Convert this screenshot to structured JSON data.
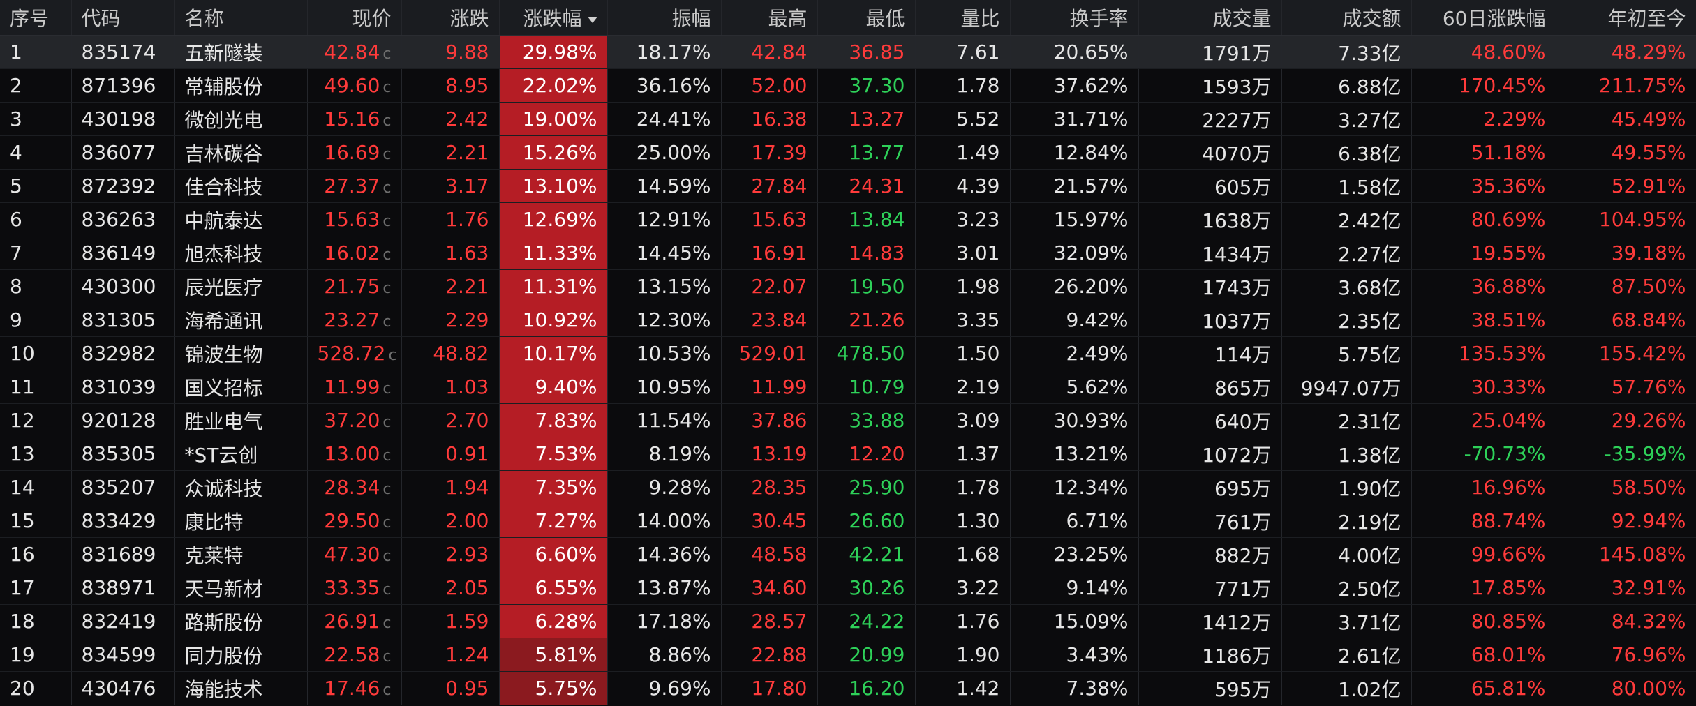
{
  "headers": [
    "序号",
    "代码",
    "名称",
    "现价",
    "涨跌",
    "涨跌幅",
    "振幅",
    "最高",
    "最低",
    "量比",
    "换手率",
    "成交量",
    "成交额",
    "60日涨跌幅",
    "年初至今"
  ],
  "colors": {
    "up": "#ff3b3b",
    "down": "#2ed159",
    "pct_bg_hot": "#b51d25",
    "pct_bg_warm": "#8b1a1f"
  },
  "sort": {
    "column": "涨跌幅",
    "direction": "desc",
    "icon": "triangle-down-icon"
  },
  "rows": [
    {
      "seq": "1",
      "code": "835174",
      "name": "五新隧装",
      "price": "42.84",
      "flag": "c",
      "change": "9.88",
      "pct": "29.98%",
      "amp": "18.17%",
      "high": "42.84",
      "high_dir": "up",
      "low": "36.85",
      "low_dir": "up",
      "vr": "7.61",
      "turn": "20.65%",
      "vol": "1791万",
      "amt": "7.33亿",
      "d60": "48.60%",
      "d60_dir": "up",
      "ytd": "48.29%",
      "ytd_dir": "up"
    },
    {
      "seq": "2",
      "code": "871396",
      "name": "常辅股份",
      "price": "49.60",
      "flag": "c",
      "change": "8.95",
      "pct": "22.02%",
      "amp": "36.16%",
      "high": "52.00",
      "high_dir": "up",
      "low": "37.30",
      "low_dir": "down",
      "vr": "1.78",
      "turn": "37.62%",
      "vol": "1593万",
      "amt": "6.88亿",
      "d60": "170.45%",
      "d60_dir": "up",
      "ytd": "211.75%",
      "ytd_dir": "up"
    },
    {
      "seq": "3",
      "code": "430198",
      "name": "微创光电",
      "price": "15.16",
      "flag": "c",
      "change": "2.42",
      "pct": "19.00%",
      "amp": "24.41%",
      "high": "16.38",
      "high_dir": "up",
      "low": "13.27",
      "low_dir": "up",
      "vr": "5.52",
      "turn": "31.71%",
      "vol": "2227万",
      "amt": "3.27亿",
      "d60": "2.29%",
      "d60_dir": "up",
      "ytd": "45.49%",
      "ytd_dir": "up"
    },
    {
      "seq": "4",
      "code": "836077",
      "name": "吉林碳谷",
      "price": "16.69",
      "flag": "c",
      "change": "2.21",
      "pct": "15.26%",
      "amp": "25.00%",
      "high": "17.39",
      "high_dir": "up",
      "low": "13.77",
      "low_dir": "down",
      "vr": "1.49",
      "turn": "12.84%",
      "vol": "4070万",
      "amt": "6.38亿",
      "d60": "51.18%",
      "d60_dir": "up",
      "ytd": "49.55%",
      "ytd_dir": "up"
    },
    {
      "seq": "5",
      "code": "872392",
      "name": "佳合科技",
      "price": "27.37",
      "flag": "c",
      "change": "3.17",
      "pct": "13.10%",
      "amp": "14.59%",
      "high": "27.84",
      "high_dir": "up",
      "low": "24.31",
      "low_dir": "up",
      "vr": "4.39",
      "turn": "21.57%",
      "vol": "605万",
      "amt": "1.58亿",
      "d60": "35.36%",
      "d60_dir": "up",
      "ytd": "52.91%",
      "ytd_dir": "up"
    },
    {
      "seq": "6",
      "code": "836263",
      "name": "中航泰达",
      "price": "15.63",
      "flag": "c",
      "change": "1.76",
      "pct": "12.69%",
      "amp": "12.91%",
      "high": "15.63",
      "high_dir": "up",
      "low": "13.84",
      "low_dir": "down",
      "vr": "3.23",
      "turn": "15.97%",
      "vol": "1638万",
      "amt": "2.42亿",
      "d60": "80.69%",
      "d60_dir": "up",
      "ytd": "104.95%",
      "ytd_dir": "up"
    },
    {
      "seq": "7",
      "code": "836149",
      "name": "旭杰科技",
      "price": "16.02",
      "flag": "c",
      "change": "1.63",
      "pct": "11.33%",
      "amp": "14.45%",
      "high": "16.91",
      "high_dir": "up",
      "low": "14.83",
      "low_dir": "up",
      "vr": "3.01",
      "turn": "32.09%",
      "vol": "1434万",
      "amt": "2.27亿",
      "d60": "19.55%",
      "d60_dir": "up",
      "ytd": "39.18%",
      "ytd_dir": "up"
    },
    {
      "seq": "8",
      "code": "430300",
      "name": "辰光医疗",
      "price": "21.75",
      "flag": "c",
      "change": "2.21",
      "pct": "11.31%",
      "amp": "13.15%",
      "high": "22.07",
      "high_dir": "up",
      "low": "19.50",
      "low_dir": "down",
      "vr": "1.98",
      "turn": "26.20%",
      "vol": "1743万",
      "amt": "3.68亿",
      "d60": "36.88%",
      "d60_dir": "up",
      "ytd": "87.50%",
      "ytd_dir": "up"
    },
    {
      "seq": "9",
      "code": "831305",
      "name": "海希通讯",
      "price": "23.27",
      "flag": "c",
      "change": "2.29",
      "pct": "10.92%",
      "amp": "12.30%",
      "high": "23.84",
      "high_dir": "up",
      "low": "21.26",
      "low_dir": "up",
      "vr": "3.35",
      "turn": "9.42%",
      "vol": "1037万",
      "amt": "2.35亿",
      "d60": "38.51%",
      "d60_dir": "up",
      "ytd": "68.84%",
      "ytd_dir": "up"
    },
    {
      "seq": "10",
      "code": "832982",
      "name": "锦波生物",
      "price": "528.72",
      "flag": "c",
      "change": "48.82",
      "pct": "10.17%",
      "amp": "10.53%",
      "high": "529.01",
      "high_dir": "up",
      "low": "478.50",
      "low_dir": "down",
      "vr": "1.50",
      "turn": "2.49%",
      "vol": "114万",
      "amt": "5.75亿",
      "d60": "135.53%",
      "d60_dir": "up",
      "ytd": "155.42%",
      "ytd_dir": "up"
    },
    {
      "seq": "11",
      "code": "831039",
      "name": "国义招标",
      "price": "11.99",
      "flag": "c",
      "change": "1.03",
      "pct": "9.40%",
      "amp": "10.95%",
      "high": "11.99",
      "high_dir": "up",
      "low": "10.79",
      "low_dir": "down",
      "vr": "2.19",
      "turn": "5.62%",
      "vol": "865万",
      "amt": "9947.07万",
      "d60": "30.33%",
      "d60_dir": "up",
      "ytd": "57.76%",
      "ytd_dir": "up"
    },
    {
      "seq": "12",
      "code": "920128",
      "name": "胜业电气",
      "price": "37.20",
      "flag": "c",
      "change": "2.70",
      "pct": "7.83%",
      "amp": "11.54%",
      "high": "37.86",
      "high_dir": "up",
      "low": "33.88",
      "low_dir": "down",
      "vr": "3.09",
      "turn": "30.93%",
      "vol": "640万",
      "amt": "2.31亿",
      "d60": "25.04%",
      "d60_dir": "up",
      "ytd": "29.26%",
      "ytd_dir": "up"
    },
    {
      "seq": "13",
      "code": "835305",
      "name": "*ST云创",
      "price": "13.00",
      "flag": "c",
      "change": "0.91",
      "pct": "7.53%",
      "amp": "8.19%",
      "high": "13.19",
      "high_dir": "up",
      "low": "12.20",
      "low_dir": "up",
      "vr": "1.37",
      "turn": "13.21%",
      "vol": "1072万",
      "amt": "1.38亿",
      "d60": "-70.73%",
      "d60_dir": "down",
      "ytd": "-35.99%",
      "ytd_dir": "down"
    },
    {
      "seq": "14",
      "code": "835207",
      "name": "众诚科技",
      "price": "28.34",
      "flag": "c",
      "change": "1.94",
      "pct": "7.35%",
      "amp": "9.28%",
      "high": "28.35",
      "high_dir": "up",
      "low": "25.90",
      "low_dir": "down",
      "vr": "1.78",
      "turn": "12.34%",
      "vol": "695万",
      "amt": "1.90亿",
      "d60": "16.96%",
      "d60_dir": "up",
      "ytd": "58.50%",
      "ytd_dir": "up"
    },
    {
      "seq": "15",
      "code": "833429",
      "name": "康比特",
      "price": "29.50",
      "flag": "c",
      "change": "2.00",
      "pct": "7.27%",
      "amp": "14.00%",
      "high": "30.45",
      "high_dir": "up",
      "low": "26.60",
      "low_dir": "down",
      "vr": "1.30",
      "turn": "6.71%",
      "vol": "761万",
      "amt": "2.19亿",
      "d60": "88.74%",
      "d60_dir": "up",
      "ytd": "92.94%",
      "ytd_dir": "up"
    },
    {
      "seq": "16",
      "code": "831689",
      "name": "克莱特",
      "price": "47.30",
      "flag": "c",
      "change": "2.93",
      "pct": "6.60%",
      "amp": "14.36%",
      "high": "48.58",
      "high_dir": "up",
      "low": "42.21",
      "low_dir": "down",
      "vr": "1.68",
      "turn": "23.25%",
      "vol": "882万",
      "amt": "4.00亿",
      "d60": "99.66%",
      "d60_dir": "up",
      "ytd": "145.08%",
      "ytd_dir": "up"
    },
    {
      "seq": "17",
      "code": "838971",
      "name": "天马新材",
      "price": "33.35",
      "flag": "c",
      "change": "2.05",
      "pct": "6.55%",
      "amp": "13.87%",
      "high": "34.60",
      "high_dir": "up",
      "low": "30.26",
      "low_dir": "down",
      "vr": "3.22",
      "turn": "9.14%",
      "vol": "771万",
      "amt": "2.50亿",
      "d60": "17.85%",
      "d60_dir": "up",
      "ytd": "32.91%",
      "ytd_dir": "up"
    },
    {
      "seq": "18",
      "code": "832419",
      "name": "路斯股份",
      "price": "26.91",
      "flag": "c",
      "change": "1.59",
      "pct": "6.28%",
      "amp": "17.18%",
      "high": "28.57",
      "high_dir": "up",
      "low": "24.22",
      "low_dir": "down",
      "vr": "1.76",
      "turn": "15.09%",
      "vol": "1412万",
      "amt": "3.71亿",
      "d60": "80.85%",
      "d60_dir": "up",
      "ytd": "84.32%",
      "ytd_dir": "up"
    },
    {
      "seq": "19",
      "code": "834599",
      "name": "同力股份",
      "price": "22.58",
      "flag": "c",
      "change": "1.24",
      "pct": "5.81%",
      "amp": "8.86%",
      "high": "22.88",
      "high_dir": "up",
      "low": "20.99",
      "low_dir": "down",
      "vr": "1.90",
      "turn": "3.43%",
      "vol": "1186万",
      "amt": "2.61亿",
      "d60": "68.01%",
      "d60_dir": "up",
      "ytd": "76.96%",
      "ytd_dir": "up"
    },
    {
      "seq": "20",
      "code": "430476",
      "name": "海能技术",
      "price": "17.46",
      "flag": "c",
      "change": "0.95",
      "pct": "5.75%",
      "amp": "9.69%",
      "high": "17.80",
      "high_dir": "up",
      "low": "16.20",
      "low_dir": "down",
      "vr": "1.42",
      "turn": "7.38%",
      "vol": "595万",
      "amt": "1.02亿",
      "d60": "65.81%",
      "d60_dir": "up",
      "ytd": "80.00%",
      "ytd_dir": "up"
    }
  ]
}
